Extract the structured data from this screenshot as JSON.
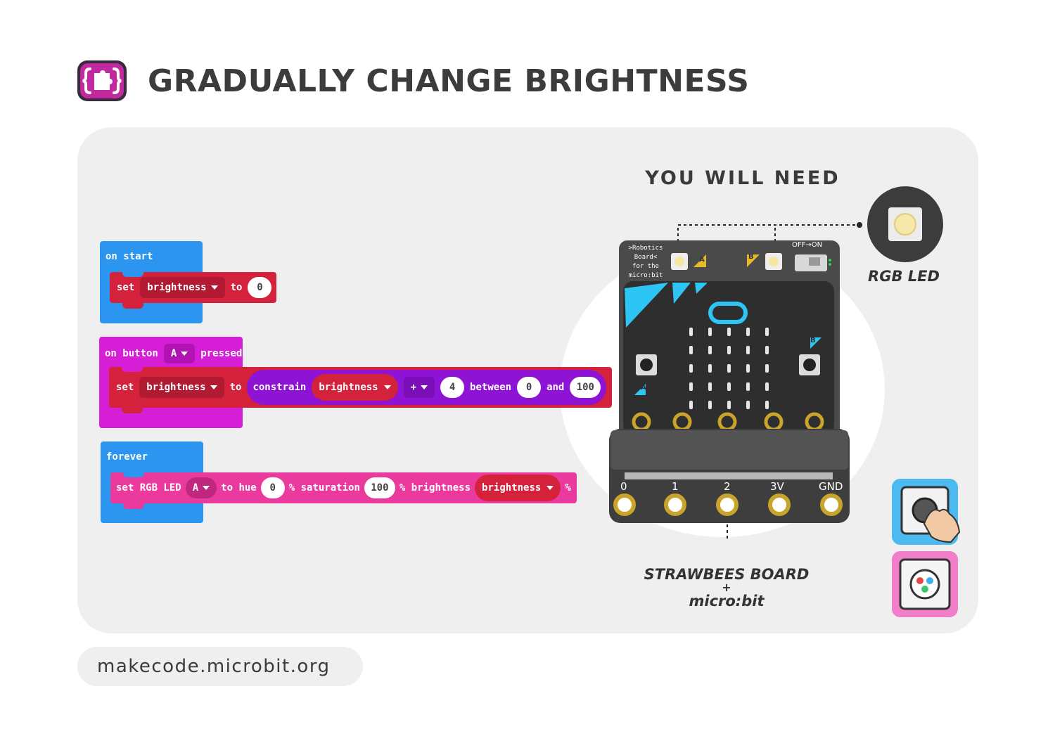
{
  "header": {
    "title": "GRADUALLY CHANGE BRIGHTNESS"
  },
  "need": {
    "title": "YOU WILL NEED",
    "rgb_led_label": "RGB LED",
    "board_label": "STRAWBEES BOARD",
    "board_plus": "+",
    "board_sub": "micro:bit"
  },
  "board": {
    "silkscreen": [
      ">Robotics",
      "Board<",
      "for the",
      "micro:bit"
    ],
    "switch_label": "OFF→ON",
    "button_a": "A",
    "button_b": "B",
    "pins": [
      "0",
      "1",
      "2",
      "3V",
      "GND"
    ]
  },
  "blocks": {
    "on_start": {
      "hat": "on start",
      "set": "set",
      "var": "brightness",
      "to": "to",
      "value": "0"
    },
    "on_button": {
      "hat_pre": "on button",
      "button": "A",
      "hat_post": "pressed",
      "set": "set",
      "var": "brightness",
      "to": "to",
      "constrain": "constrain",
      "cvar": "brightness",
      "op": "+",
      "step": "4",
      "between": "between",
      "min": "0",
      "and": "and",
      "max": "100"
    },
    "forever": {
      "hat": "forever",
      "set": "set RGB LED",
      "led": "A",
      "to_hue": "to hue",
      "hue": "0",
      "sat_label": "% saturation",
      "sat": "100",
      "bright_label": "% brightness",
      "bright_var": "brightness",
      "pct": "%"
    }
  },
  "footer": {
    "url": "makecode.microbit.org"
  },
  "colors": {
    "events": "#2c95f0",
    "variables": "#d4213c",
    "input": "#d51ed6",
    "pins": "#8e13d5",
    "led": "#ea3a9d"
  }
}
